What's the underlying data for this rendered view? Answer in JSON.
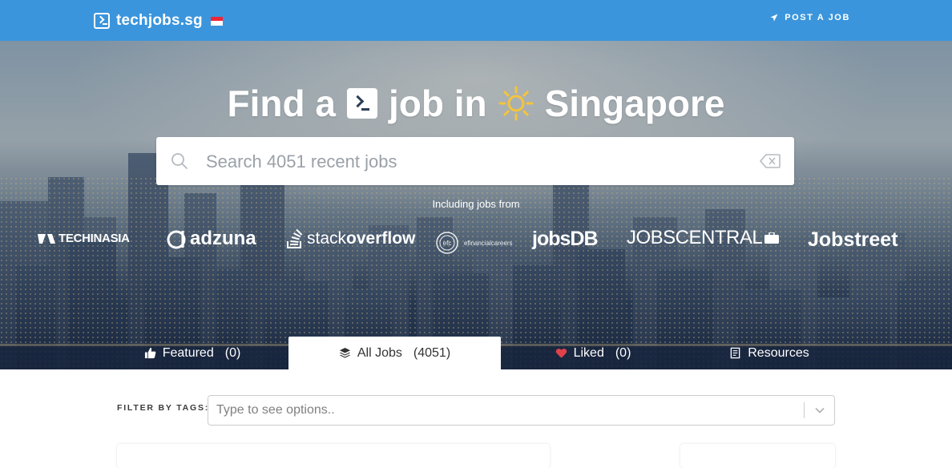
{
  "header": {
    "brand": "techjobs.sg",
    "post_job": "POST A JOB",
    "brand_color": "#3b95dc"
  },
  "hero": {
    "headline_part1": "Find a",
    "headline_part2": "job in",
    "headline_part3": "Singapore",
    "search_placeholder": "Search 4051 recent jobs",
    "including": "Including jobs from",
    "logos": {
      "techinasia": "TECHINASIA",
      "adzuna": "adzuna",
      "stackoverflow_a": "stack",
      "stackoverflow_b": "overflow",
      "efc": "efinancialcareers",
      "jobsdb": "jobsDB",
      "jobscentral": "JOBSCENTRAL",
      "jobstreet": "Jobstreet"
    }
  },
  "tabs": {
    "featured": {
      "label": "Featured",
      "count": "(0)"
    },
    "all": {
      "label": "All Jobs",
      "count": "(4051)"
    },
    "liked": {
      "label": "Liked",
      "count": "(0)"
    },
    "resources": {
      "label": "Resources"
    }
  },
  "filter": {
    "label": "FILTER BY TAGS:",
    "placeholder": "Type to see options.."
  },
  "icons": {
    "brand": "terminal-icon",
    "flag": "singapore-flag-icon",
    "post": "send-icon",
    "search": "search-icon",
    "clear": "backspace-icon",
    "featured": "thumbs-up-icon",
    "all": "layers-icon",
    "liked": "heart-icon",
    "resources": "document-icon"
  }
}
